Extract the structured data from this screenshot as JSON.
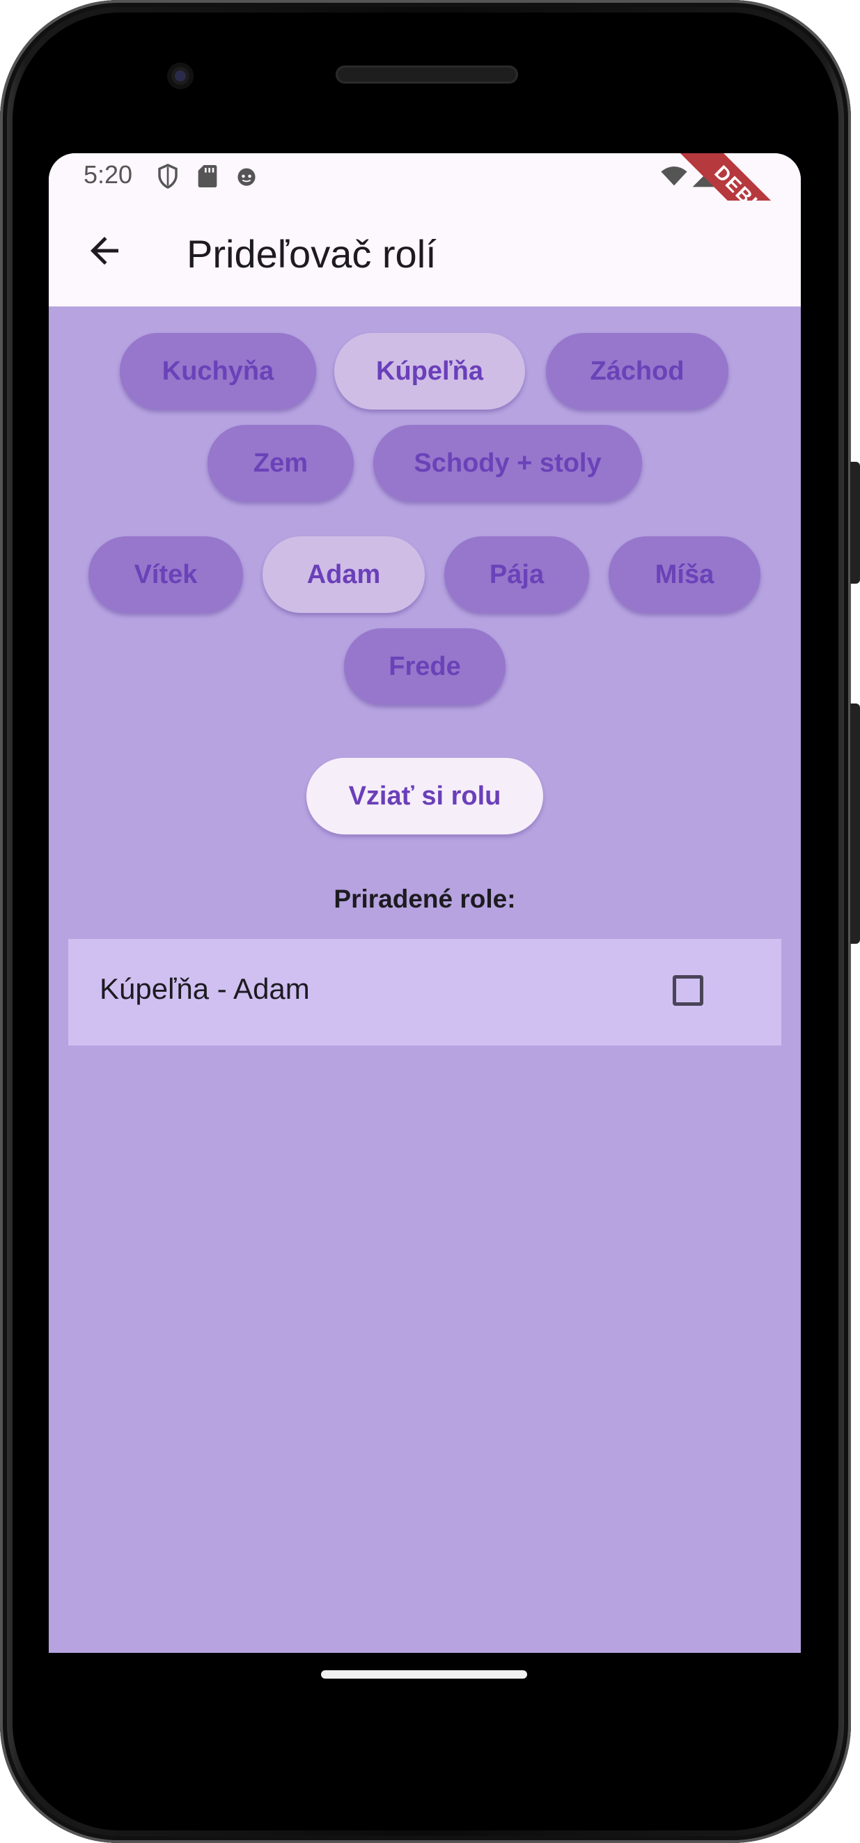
{
  "status_bar": {
    "time": "5:20",
    "icons": [
      "shield-icon",
      "sd-card-icon",
      "android-face-icon",
      "wifi-icon",
      "signal-icon",
      "battery-icon"
    ],
    "debug_banner": "DEBUG"
  },
  "app_bar": {
    "title": "Prideľovač rolí",
    "back_icon": "back-arrow-icon"
  },
  "rooms": [
    {
      "label": "Kuchyňa",
      "selected": false
    },
    {
      "label": "Kúpeľňa",
      "selected": true
    },
    {
      "label": "Záchod",
      "selected": false
    },
    {
      "label": "Zem",
      "selected": false
    },
    {
      "label": "Schody + stoly",
      "selected": false
    }
  ],
  "people": [
    {
      "label": "Vítek",
      "selected": false
    },
    {
      "label": "Adam",
      "selected": true
    },
    {
      "label": "Pája",
      "selected": false
    },
    {
      "label": "Míša",
      "selected": false
    },
    {
      "label": "Frede",
      "selected": false
    }
  ],
  "take_role_button": "Vziať si rolu",
  "assigned_section_label": "Priradené role:",
  "assigned_roles": [
    {
      "text": "Kúpeľňa - Adam",
      "checked": false
    }
  ],
  "colors": {
    "background": "#b6a3e0",
    "chip": "#9677cc",
    "chip_selected": "#cfbde6",
    "accent_text": "#6a3fb9",
    "app_bar": "#fdf7fe"
  }
}
